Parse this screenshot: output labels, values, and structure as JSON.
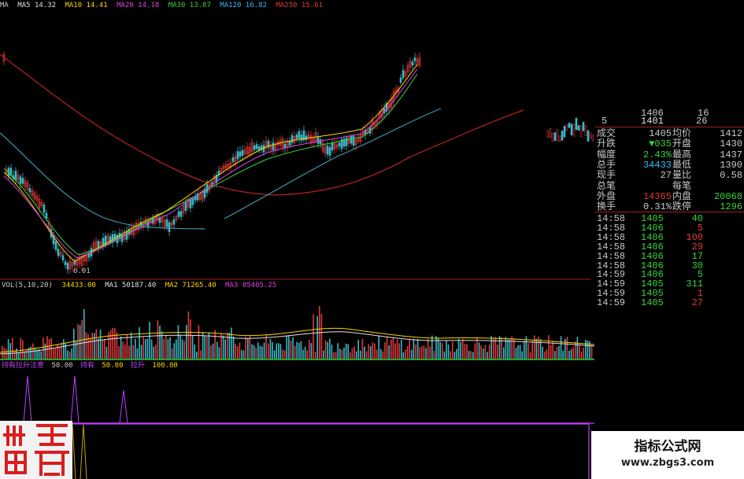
{
  "colors": {
    "up": "#e03a3a",
    "down": "#3ab8c8",
    "yellow": "#ffd200",
    "purple": "#c040ff",
    "text": "#c8c8c8",
    "border": "#a02020"
  },
  "topbar": {
    "ma_label": "MA",
    "ma5": "MA5 14.32",
    "ma10": "MA10 14.41",
    "ma20": "MA20 14.18",
    "ma30": "MA30 13.87",
    "ma120": "MA120 16.82",
    "ma250": "MA250 15.61"
  },
  "main": {
    "low_label": "6.01"
  },
  "volume": {
    "label": "VOL(5,10,20)",
    "value": "34433.00",
    "ma1": "MA1 50187.40",
    "ma2": "MA2 71265.40",
    "ma3": "MA3 85405.25"
  },
  "indicator": {
    "label": "持有拉升注意",
    "v1": "50.00",
    "hold_label": "持有",
    "v2": "50.00",
    "rise_label": "拉升",
    "v3": "100.00"
  },
  "quote_top": {
    "r1_price": "1406",
    "r1_vol": "16",
    "r2_level": "5",
    "r2_price": "1401",
    "r2_vol": "26"
  },
  "quote_rows": [
    {
      "l1": "成交",
      "v1": "1405",
      "l2": "均价",
      "v2": "1412",
      "c1": "#c8c8c8",
      "c2": "#c8c8c8"
    },
    {
      "l1": "升跌",
      "v1": "▼035",
      "l2": "开盘",
      "v2": "1430",
      "c1": "#3ad23a",
      "c2": "#c8c8c8"
    },
    {
      "l1": "幅度",
      "v1": "2.43%",
      "l2": "最高",
      "v2": "1437",
      "c1": "#3ad23a",
      "c2": "#c8c8c8"
    },
    {
      "l1": "总手",
      "v1": "34433",
      "l2": "最低",
      "v2": "1390",
      "c1": "#3ab8ff",
      "c2": "#c8c8c8"
    },
    {
      "l1": "现手",
      "v1": "27",
      "l2": "量比",
      "v2": "0.58",
      "c1": "#c8c8c8",
      "c2": "#c8c8c8"
    },
    {
      "l1": "总笔",
      "v1": "",
      "l2": "每笔",
      "v2": "",
      "c1": "#c8c8c8",
      "c2": "#c8c8c8"
    },
    {
      "l1": "外盘",
      "v1": "14365",
      "l2": "内盘",
      "v2": "20068",
      "c1": "#e03a3a",
      "c2": "#3ad23a"
    },
    {
      "l1": "换手",
      "v1": "0.31%",
      "l2": "跌停",
      "v2": "1296",
      "c1": "#c8c8c8",
      "c2": "#3ad23a"
    }
  ],
  "ticks": [
    {
      "time": "14:58",
      "price": "1405",
      "vol": "40",
      "vc": "#3ad23a"
    },
    {
      "time": "14:58",
      "price": "1406",
      "vol": "5",
      "vc": "#e03a3a"
    },
    {
      "time": "14:58",
      "price": "1406",
      "vol": "100",
      "vc": "#e03a3a"
    },
    {
      "time": "14:58",
      "price": "1406",
      "vol": "29",
      "vc": "#e03a3a"
    },
    {
      "time": "14:58",
      "price": "1406",
      "vol": "17",
      "vc": "#3ad23a"
    },
    {
      "time": "14:58",
      "price": "1406",
      "vol": "30",
      "vc": "#3ad23a"
    },
    {
      "time": "14:59",
      "price": "1406",
      "vol": "5",
      "vc": "#3ad23a"
    },
    {
      "time": "14:59",
      "price": "1405",
      "vol": "311",
      "vc": "#3ad23a"
    },
    {
      "time": "14:59",
      "price": "1405",
      "vol": "1",
      "vc": "#e03a3a"
    },
    {
      "time": "14:59",
      "price": "1405",
      "vol": "27",
      "vc": "#e03a3a"
    }
  ],
  "watermark": {
    "title": "指标公式网",
    "url": "www.zbgs3.com"
  }
}
